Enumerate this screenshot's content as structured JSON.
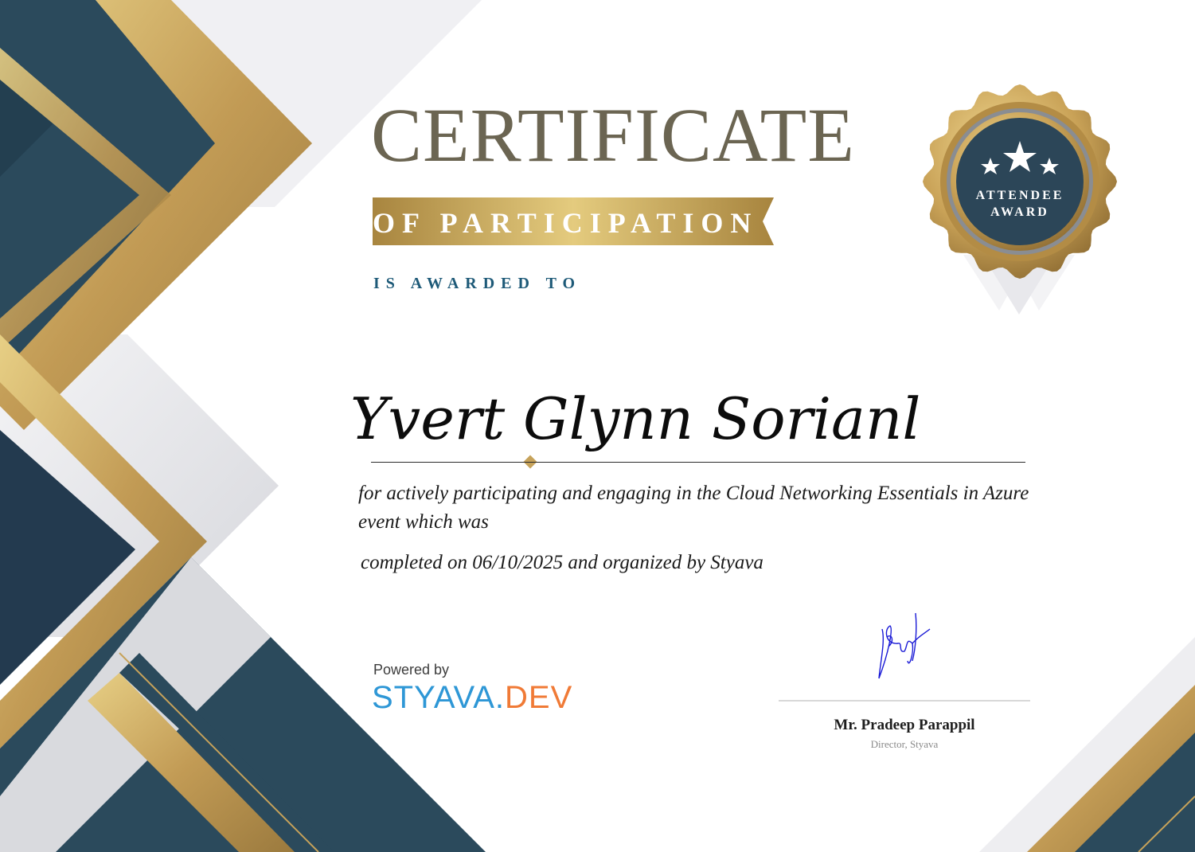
{
  "certificate": {
    "title": "CERTIFICATE",
    "subtitle": "OF PARTICIPATION",
    "awarded_to": "IS AWARDED TO",
    "recipient_name": "Yvert Glynn Sorianl",
    "description": "for actively participating and engaging in the Cloud Networking Essentials in Azure event which was",
    "completion": "completed on 06/10/2025 and organized by Styava"
  },
  "seal": {
    "line1": "ATTENDEE",
    "line2": "AWARD",
    "stars": 3
  },
  "branding": {
    "powered_by": "Powered by",
    "logo_part1": "STYAVA.",
    "logo_part2": "DEV"
  },
  "signatory": {
    "name": "Mr. Pradeep Parappil",
    "title": "Director, Styava"
  },
  "colors": {
    "navy": "#2a4456",
    "gold": "#c6a25a",
    "gold_light": "#e2c77d",
    "title_text": "#6b6552",
    "accent_blue": "#1e5a78"
  }
}
